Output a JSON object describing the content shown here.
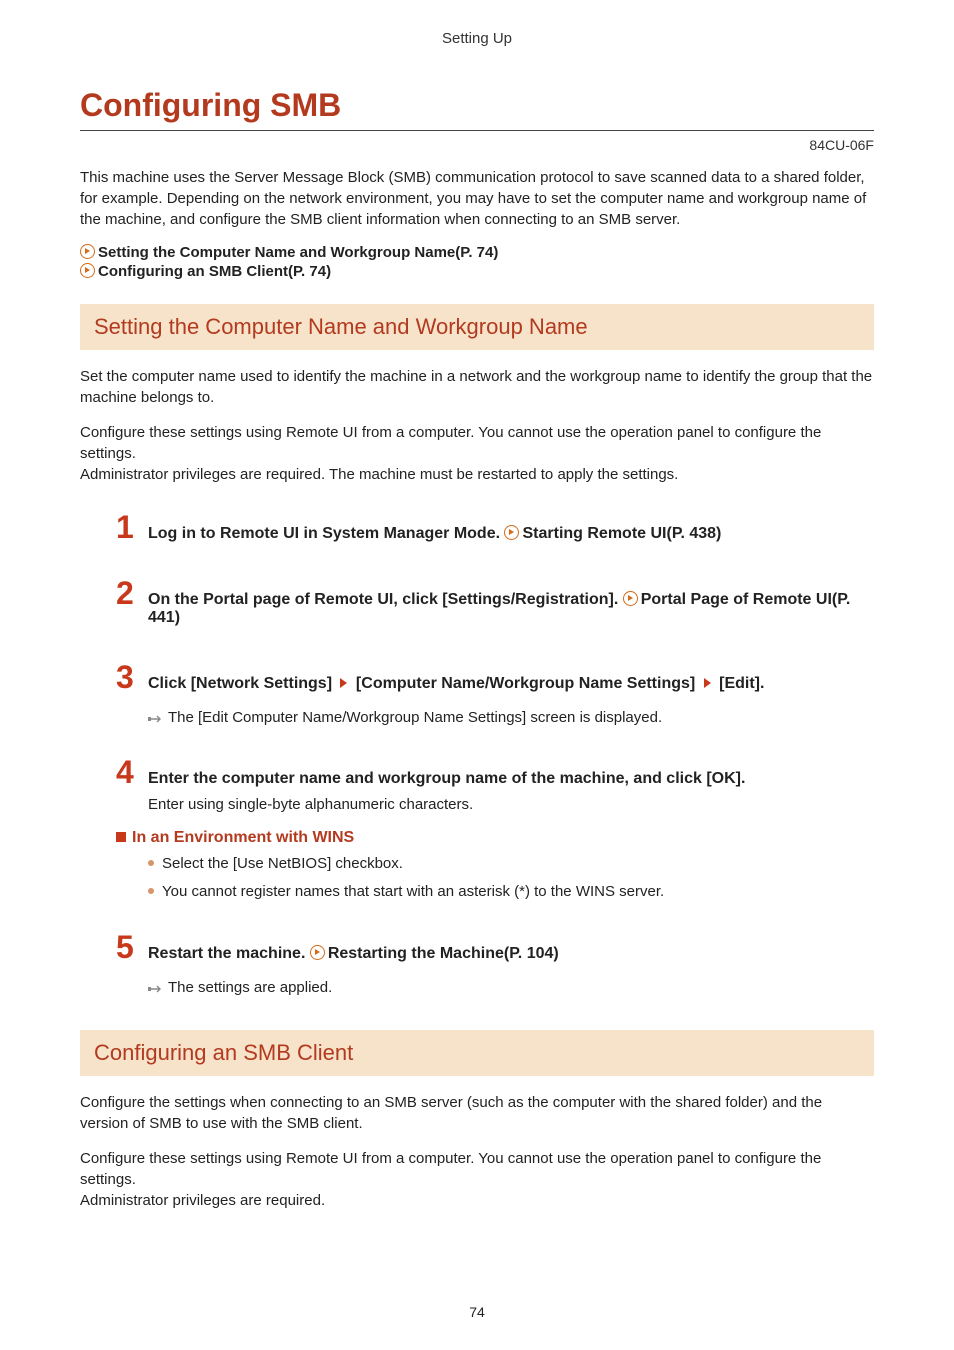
{
  "header": "Setting Up",
  "title": "Configuring SMB",
  "doc_code": "84CU-06F",
  "intro": "This machine uses the Server Message Block (SMB) communication protocol to save scanned data to a shared folder, for example. Depending on the network environment, you may have to set the computer name and workgroup name of the machine, and configure the SMB client information when connecting to an SMB server.",
  "toc": {
    "item1": "Setting the Computer Name and Workgroup Name(P. 74)",
    "item2": "Configuring an SMB Client(P. 74)"
  },
  "section1": {
    "title": "Setting the Computer Name and Workgroup Name",
    "p1": "Set the computer name used to identify the machine in a network and the workgroup name to identify the group that the machine belongs to.",
    "p2": "Configure these settings using Remote UI from a computer. You cannot use the operation panel to configure the settings.",
    "p3": "Administrator privileges are required. The machine must be restarted to apply the settings.",
    "step1": {
      "num": "1",
      "text_a": "Log in to Remote UI in System Manager Mode. ",
      "link": "Starting Remote UI(P. 438)"
    },
    "step2": {
      "num": "2",
      "text_a": "On the Portal page of Remote UI, click [Settings/Registration]. ",
      "link": "Portal Page of Remote UI(P. 441)"
    },
    "step3": {
      "num": "3",
      "seg1": "Click [Network Settings] ",
      "seg2": " [Computer Name/Workgroup Name Settings] ",
      "seg3": " [Edit].",
      "result": "The [Edit Computer Name/Workgroup Name Settings] screen is displayed."
    },
    "step4": {
      "num": "4",
      "text": "Enter the computer name and workgroup name of the machine, and click [OK].",
      "body": "Enter using single-byte alphanumeric characters.",
      "sub_title": "In an Environment with WINS",
      "bullet1": "Select the [Use NetBIOS] checkbox.",
      "bullet2": "You cannot register names that start with an asterisk (*) to the WINS server."
    },
    "step5": {
      "num": "5",
      "text_a": "Restart the machine. ",
      "link": "Restarting the Machine(P. 104)",
      "result": "The settings are applied."
    }
  },
  "section2": {
    "title": "Configuring an SMB Client",
    "p1": "Configure the settings when connecting to an SMB server (such as the computer with the shared folder) and the version of SMB to use with the SMB client.",
    "p2": "Configure these settings using Remote UI from a computer. You cannot use the operation panel to configure the settings.",
    "p3": "Administrator privileges are required."
  },
  "page_number": "74"
}
